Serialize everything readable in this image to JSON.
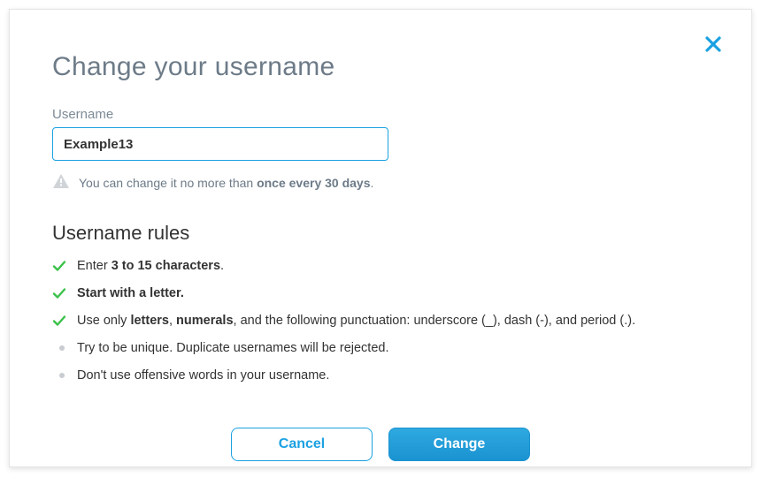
{
  "modal": {
    "title": "Change your username",
    "field_label": "Username",
    "input_value": "Example13",
    "warning_prefix": "You can change it no more than ",
    "warning_bold": "once every 30 days",
    "warning_suffix": ".",
    "rules_title": "Username rules",
    "rules": [
      {
        "type": "check",
        "prefix": "Enter ",
        "bold": "3 to 15 characters",
        "suffix": "."
      },
      {
        "type": "check",
        "prefix": "",
        "bold": "Start with a letter.",
        "suffix": ""
      },
      {
        "type": "check",
        "prefix": "Use only ",
        "bold": "letters",
        "mid1": ", ",
        "bold2": "numerals",
        "suffix": ", and the following punctuation: underscore (_), dash (-), and period (.)."
      },
      {
        "type": "dot",
        "text": "Try to be unique. Duplicate usernames will be rejected."
      },
      {
        "type": "dot",
        "text": "Don't use offensive words in your username."
      }
    ],
    "cancel_label": "Cancel",
    "change_label": "Change"
  },
  "colors": {
    "accent": "#1ba1e2",
    "success": "#3cc14a",
    "muted": "#6d7b88"
  }
}
